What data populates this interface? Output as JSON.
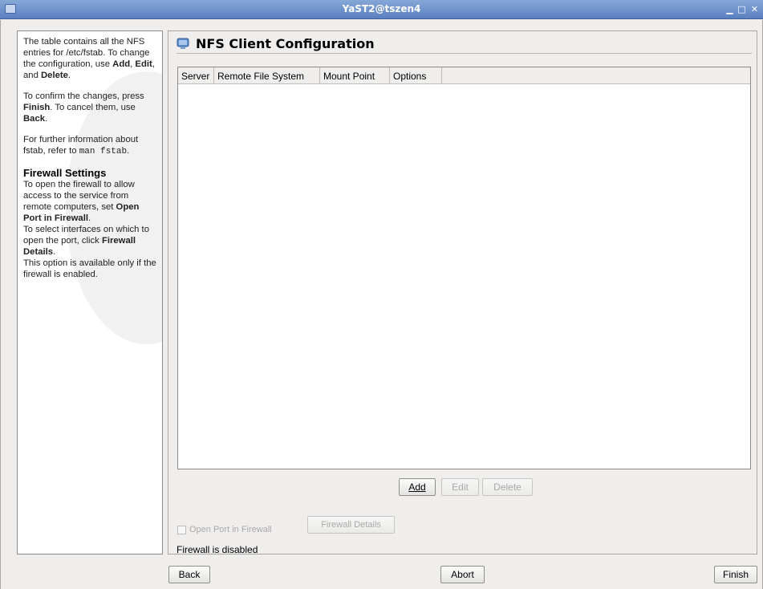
{
  "window": {
    "title": "YaST2@tszen4"
  },
  "help": {
    "p1_a": "The table contains all the NFS entries for /etc/fstab. To change the configuration, use ",
    "p1_add": "Add",
    "p1_sep1": ", ",
    "p1_edit": "Edit",
    "p1_sep2": ", and ",
    "p1_delete": "Delete",
    "p1_end": ".",
    "p2_a": "To confirm the changes, press ",
    "p2_finish": "Finish",
    "p2_b": ". To cancel them, use ",
    "p2_back": "Back",
    "p2_end": ".",
    "p3_a": "For further information about fstab, refer to ",
    "p3_code": "man fstab",
    "p3_end": ".",
    "fw_heading": "Firewall Settings",
    "fw_p1_a": "To open the firewall to allow access to the service from remote computers, set ",
    "fw_p1_b": "Open Port in Firewall",
    "fw_p1_end": ".",
    "fw_p2_a": "To select interfaces on which to open the port, click ",
    "fw_p2_b": "Firewall Details",
    "fw_p2_end": ".",
    "fw_p3": "This option is available only if the firewall is enabled."
  },
  "main": {
    "heading": "NFS Client Configuration",
    "columns": [
      "Server",
      "Remote File System",
      "Mount Point",
      "Options"
    ],
    "buttons": {
      "add": "Add",
      "edit": "Edit",
      "delete": "Delete"
    },
    "open_port_label": "Open Port in Firewall",
    "firewall_details": "Firewall Details",
    "status": "Firewall is disabled"
  },
  "footer": {
    "back": "Back",
    "abort": "Abort",
    "finish": "Finish"
  }
}
